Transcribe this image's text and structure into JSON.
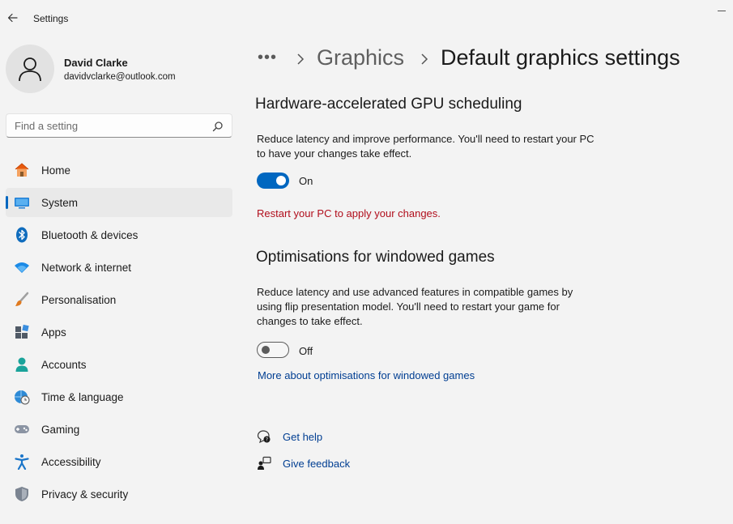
{
  "app": {
    "title": "Settings"
  },
  "user": {
    "name": "David Clarke",
    "email": "davidvclarke@outlook.com"
  },
  "search": {
    "placeholder": "Find a setting"
  },
  "nav": {
    "items": [
      {
        "label": "Home",
        "icon": "home-icon"
      },
      {
        "label": "System",
        "icon": "system-icon",
        "selected": true
      },
      {
        "label": "Bluetooth & devices",
        "icon": "bluetooth-icon"
      },
      {
        "label": "Network & internet",
        "icon": "wifi-icon"
      },
      {
        "label": "Personalisation",
        "icon": "brush-icon"
      },
      {
        "label": "Apps",
        "icon": "apps-icon"
      },
      {
        "label": "Accounts",
        "icon": "accounts-icon"
      },
      {
        "label": "Time & language",
        "icon": "globe-clock-icon"
      },
      {
        "label": "Gaming",
        "icon": "gamepad-icon"
      },
      {
        "label": "Accessibility",
        "icon": "accessibility-icon"
      },
      {
        "label": "Privacy & security",
        "icon": "shield-icon"
      }
    ]
  },
  "breadcrumb": {
    "more": "•••",
    "parent": "Graphics",
    "current": "Default graphics settings"
  },
  "gpu": {
    "title": "Hardware-accelerated GPU scheduling",
    "desc_line1": "Reduce latency and improve performance. You'll need to restart your PC",
    "desc_line2": "to have your changes take effect.",
    "toggle_state": "On",
    "warning": "Restart your PC to apply your changes."
  },
  "windowed": {
    "title": "Optimisations for windowed games",
    "desc_line1": "Reduce latency and use advanced features in compatible games by",
    "desc_line2": "using flip presentation model. You'll need to restart your game for",
    "desc_line3": "changes to take effect.",
    "toggle_state": "Off",
    "link": "More about optimisations for windowed games"
  },
  "help": {
    "get_help": "Get help",
    "give_feedback": "Give feedback"
  },
  "colors": {
    "accent": "#0067c0",
    "warning": "#b10e1c",
    "link": "#003e92"
  }
}
